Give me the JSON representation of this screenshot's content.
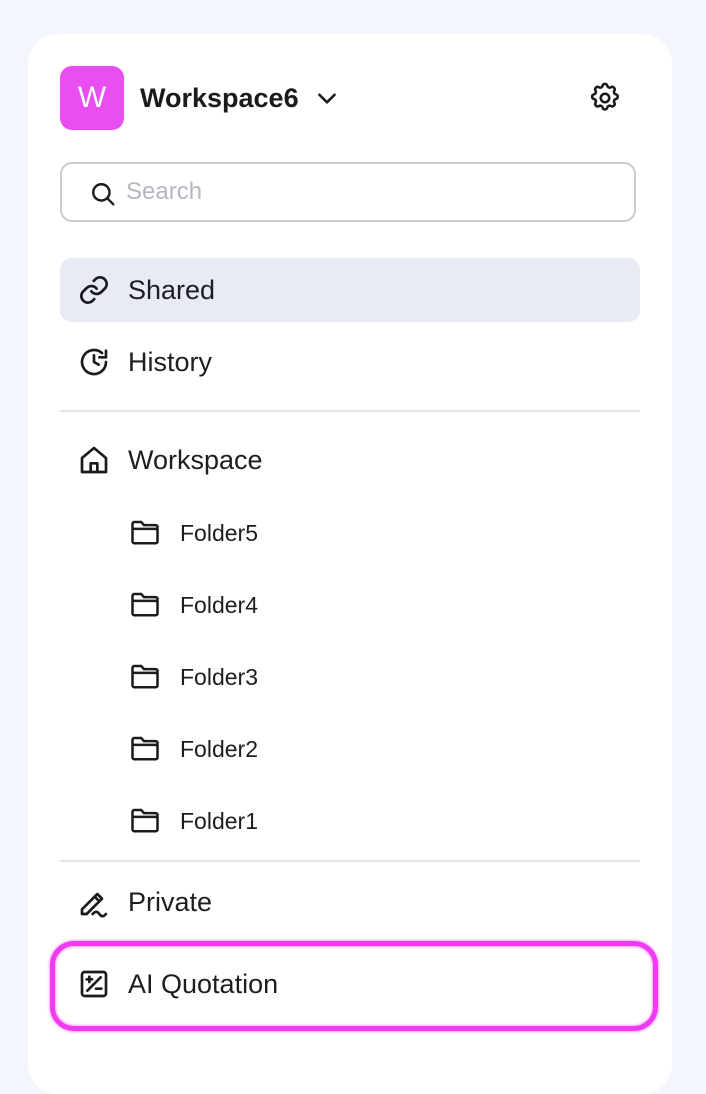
{
  "workspace": {
    "avatar_letter": "W",
    "avatar_color": "#e94ef0",
    "name": "Workspace6",
    "chevron_icon": "chevron-down-icon",
    "settings_icon": "gear-icon"
  },
  "search": {
    "placeholder": "Search",
    "value": "",
    "icon": "search-icon"
  },
  "nav": {
    "shared": {
      "label": "Shared",
      "icon": "link-icon",
      "active": true
    },
    "history": {
      "label": "History",
      "icon": "history-icon"
    },
    "workspace": {
      "label": "Workspace",
      "icon": "home-icon"
    },
    "folders": [
      {
        "label": "Folder5",
        "icon": "folder-icon"
      },
      {
        "label": "Folder4",
        "icon": "folder-icon"
      },
      {
        "label": "Folder3",
        "icon": "folder-icon"
      },
      {
        "label": "Folder2",
        "icon": "folder-icon"
      },
      {
        "label": "Folder1",
        "icon": "folder-icon"
      }
    ],
    "private": {
      "label": "Private",
      "icon": "pen-icon"
    },
    "ai_quotation": {
      "label": "AI Quotation",
      "icon": "calculator-icon",
      "highlighted": true
    }
  },
  "colors": {
    "background": "#f4f6fd",
    "panel": "#ffffff",
    "active_item": "#e9ebf4",
    "highlight": "#f03af2",
    "text": "#1d1d22",
    "placeholder": "#b4b7c0"
  }
}
